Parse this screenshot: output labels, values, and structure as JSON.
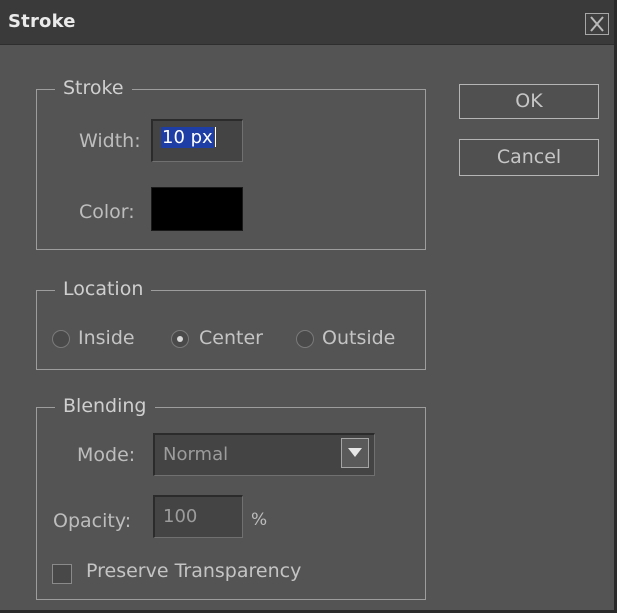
{
  "dialog": {
    "title": "Stroke",
    "close_glyph": "X"
  },
  "stroke_group": {
    "legend": "Stroke",
    "width_label": "Width:",
    "width_value": "10 px",
    "color_label": "Color:",
    "color_value": "#000000"
  },
  "location_group": {
    "legend": "Location",
    "options": [
      {
        "label": "Inside",
        "checked": false
      },
      {
        "label": "Center",
        "checked": true
      },
      {
        "label": "Outside",
        "checked": false
      }
    ]
  },
  "blending_group": {
    "legend": "Blending",
    "mode_label": "Mode:",
    "mode_value": "Normal",
    "opacity_label": "Opacity:",
    "opacity_value": "100",
    "opacity_unit": "%",
    "preserve_label": "Preserve Transparency",
    "preserve_checked": false
  },
  "buttons": {
    "ok": "OK",
    "cancel": "Cancel"
  }
}
